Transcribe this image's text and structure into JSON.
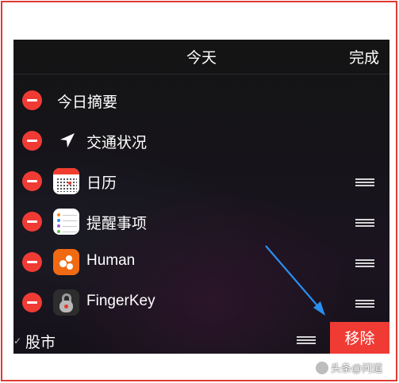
{
  "header": {
    "title": "今天",
    "done_label": "完成"
  },
  "rows": [
    {
      "label": "今日摘要"
    },
    {
      "label": "交通状况"
    },
    {
      "label": "日历"
    },
    {
      "label": "提醒事项"
    },
    {
      "label": "Human"
    },
    {
      "label": "FingerKey"
    },
    {
      "label": "股市"
    }
  ],
  "actions": {
    "remove_label": "移除"
  },
  "watermark": {
    "text": "头条@问道"
  },
  "colors": {
    "frame": "#e03a34",
    "delete_red": "#f03b35",
    "arrow": "#2b8ff0",
    "human_orange": "#f06a13"
  }
}
